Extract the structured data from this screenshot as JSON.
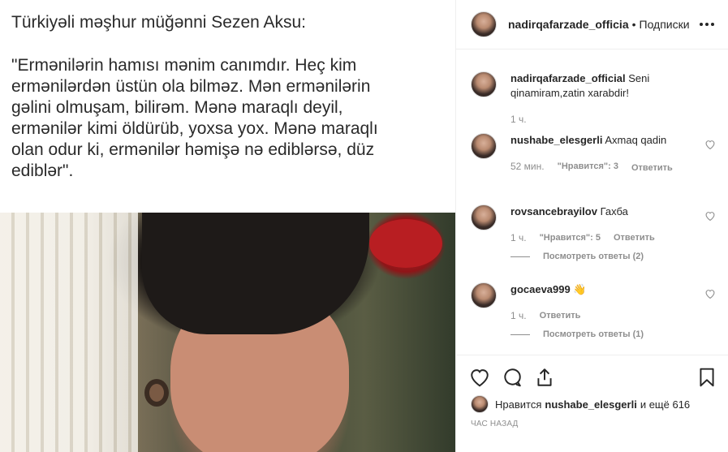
{
  "post": {
    "caption_title": "Türkiyəli məşhur müğənni Sezen Aksu:",
    "caption_quote": "\"Ermənilərin hamısı mənim canımdır. Heç kim\nermənilərdən üstün ola bilməz. Mən ermənilərin\ngəlini olmuşam, bilirəm. Mənə maraqlı deyil,\nermənilər kimi öldürüb, yoxsa yox. Mənə maraqlı\nolan odur ki, ermənilər həmişə nə ediblərsə, düz\nediblər\"."
  },
  "header": {
    "username": "nadirqafarzade_officia",
    "separator": "•",
    "follow_label": "Подписки"
  },
  "comments": [
    {
      "user": "nadirqafarzade_official",
      "text": " Seni qinamiram,zatin xarabdir!",
      "time": "1 ч."
    },
    {
      "user": "nushabe_elesgerli",
      "text": " Axmaq qadin",
      "time": "52 мин.",
      "likes": "\"Нравится\": 3",
      "reply": "Ответить"
    },
    {
      "user": "rovsancebrayilov",
      "text": " Гахба",
      "time": "1 ч.",
      "likes": "\"Нравится\": 5",
      "reply": "Ответить",
      "view_replies": "Посмотреть ответы (2)"
    },
    {
      "user": "gocaeva999",
      "text": " 👋",
      "time": "1 ч.",
      "reply": "Ответить",
      "view_replies": "Посмотреть ответы (1)"
    }
  ],
  "likes_line": {
    "prefix": "Нравится",
    "user": "nushabe_elesgerli",
    "suffix": "и ещё 616"
  },
  "timestamp": "час назад",
  "icons": {
    "like": "heart-icon",
    "comment": "comment-icon",
    "share": "share-icon",
    "save": "bookmark-icon",
    "more": "more-dots-icon"
  }
}
